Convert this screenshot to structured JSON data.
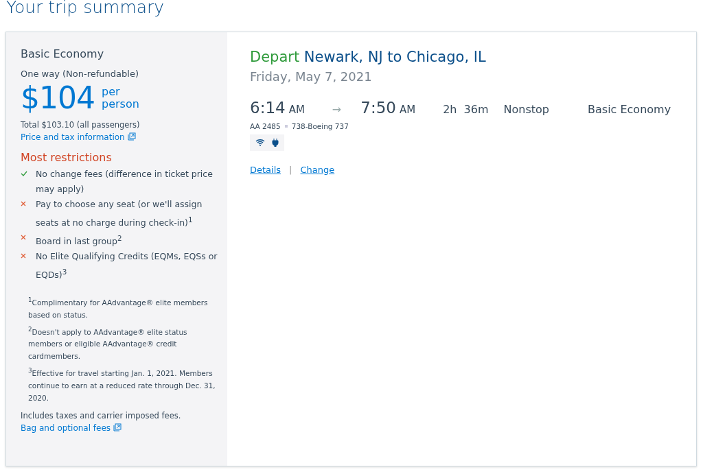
{
  "page_title": "Your trip summary",
  "fare": {
    "name": "Basic Economy",
    "trip_type": "One way (Non-refundable)",
    "price": "$104",
    "price_unit": "per person",
    "total": "Total $103.10 (all passengers)",
    "price_link": "Price and tax information"
  },
  "restrictions": {
    "title": "Most restrictions",
    "items": [
      {
        "kind": "included",
        "text": "No change fees (difference in ticket price may apply)"
      },
      {
        "kind": "excluded",
        "text": "Pay to choose any seat (or we'll assign seats at no charge during check-in)$^{1}$"
      },
      {
        "kind": "excluded",
        "text": "Board in last group$^{2}$"
      },
      {
        "kind": "excluded",
        "text": "No Elite Qualifying Credits (EQMs, EQSs or EQDs)$^{3}$"
      }
    ]
  },
  "footnotes": [
    "$^{1}$Complimentary for AAdvantage® elite members based on status.",
    "$^{2}$Doesn't apply to AAdvantage® elite status members or eligible AAdvantage® credit cardmembers.",
    "$^{3}$Effective for travel starting Jan. 1, 2021. Members continue to earn at a reduced rate through Dec. 31, 2020."
  ],
  "fees_note": "Includes taxes and carrier imposed fees.",
  "fees_link": "Bag and optional fees",
  "flight": {
    "label": "Depart",
    "route": "Newark, NJ to Chicago, IL",
    "date": "Friday, May 7, 2021",
    "depart_time": "6:14",
    "depart_ampm": "AM",
    "arrow": "→",
    "arrive_time": "7:50",
    "arrive_ampm": "AM",
    "duration": "2h  36m",
    "stops": "Nonstop",
    "cabin": "Basic Economy",
    "flight_number": "AA 2485",
    "aircraft": "738-Boeing 737",
    "amenities": [
      {
        "kind": "wifi"
      },
      {
        "kind": "power"
      }
    ],
    "links": [
      "Details",
      "Change"
    ],
    "link_separator": "|"
  }
}
